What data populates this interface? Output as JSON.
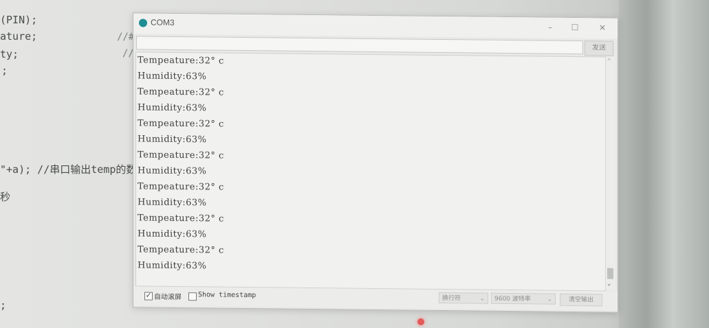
{
  "editor": {
    "lines": [
      {
        "text": "(PIN);"
      },
      {
        "text": "ature;"
      },
      {
        "text": "ty;"
      },
      {
        "text": ";"
      },
      {
        "text": "\"+a); //串口输出temp的数"
      },
      {
        "text": "秒"
      },
      {
        "text": ";"
      }
    ],
    "comments": [
      "//#",
      "//"
    ]
  },
  "window": {
    "title": "COM3",
    "controls": {
      "minimize": "–",
      "maximize": "☐",
      "close": "✕"
    },
    "send": {
      "input_value": "",
      "button_label": "发送"
    },
    "output_lines": [
      "Tempeature:32° c",
      "Humidity:63%",
      "Tempeature:32° c",
      "Humidity:63%",
      "Tempeature:32° c",
      "Humidity:63%",
      "Tempeature:32° c",
      "Humidity:63%",
      "Tempeature:32° c",
      "Humidity:63%",
      "Tempeature:32° c",
      "Humidity:63%",
      "Tempeature:32° c",
      "Humidity:63%"
    ],
    "status": {
      "autoscroll_checked": true,
      "autoscroll_mark": "✓",
      "autoscroll_label": "自动滚屏",
      "timestamp_checked": false,
      "timestamp_label": "Show timestamp",
      "line_ending": "换行符",
      "baud_rate": "9600 波特率",
      "clear_label": "清空输出"
    }
  },
  "colors": {
    "app_icon": "#1f8e93",
    "indicator": "#e35a5a"
  }
}
